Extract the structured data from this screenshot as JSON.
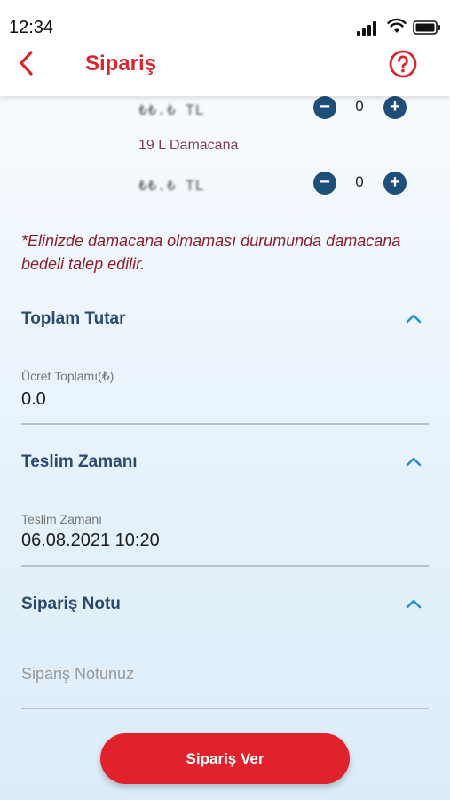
{
  "status_bar": {
    "time": "12:34"
  },
  "header": {
    "title": "Sipariş"
  },
  "products": [
    {
      "price": "₺₺.₺ TL",
      "quantity": "0"
    },
    {
      "name": "19 L Damacana",
      "price": "₺₺.₺ TL",
      "quantity": "0"
    }
  ],
  "warning": "*Elinizde damacana olmaması durumunda damacana bedeli talep edilir.",
  "total_section": {
    "title": "Toplam Tutar",
    "field_label": "Ücret Toplamı(₺)",
    "field_value": "0.0"
  },
  "delivery_section": {
    "title": "Teslim Zamanı",
    "field_label": "Teslim Zamanı",
    "field_value": "06.08.2021 10:20"
  },
  "note_section": {
    "title": "Sipariş Notu",
    "placeholder": "Sipariş Notunuz"
  },
  "submit_label": "Sipariş Ver",
  "colors": {
    "brand": "#d7282f",
    "stepper": "#1f4e79",
    "section_title": "#2b4a6b",
    "chevron": "#2b8fd6"
  }
}
